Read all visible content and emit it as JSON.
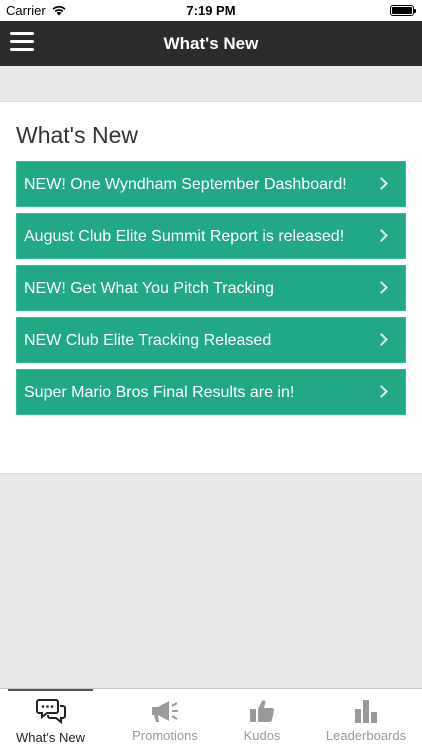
{
  "status_bar": {
    "carrier": "Carrier",
    "time": "7:19 PM",
    "wifi_icon": "wifi-icon",
    "battery_icon": "battery-icon"
  },
  "nav": {
    "title": "What's New",
    "menu_icon": "hamburger-menu-icon"
  },
  "main": {
    "section_title": "What's New",
    "accent_color": "#21a887",
    "items": [
      {
        "label": "NEW! One Wyndham September Dashboard!"
      },
      {
        "label": "August Club Elite Summit Report is released!"
      },
      {
        "label": "NEW! Get What You Pitch Tracking"
      },
      {
        "label": "NEW Club Elite Tracking Released"
      },
      {
        "label": "Super Mario Bros Final Results are in!"
      }
    ]
  },
  "tab_bar": {
    "active_tab": "What's New",
    "tabs": [
      {
        "label": "What's New",
        "icon": "chat-bubbles-icon"
      },
      {
        "label": "Promotions",
        "icon": "megaphone-icon"
      },
      {
        "label": "Kudos",
        "icon": "thumbs-up-icon"
      },
      {
        "label": "Leaderboards",
        "icon": "bar-chart-icon"
      }
    ]
  }
}
